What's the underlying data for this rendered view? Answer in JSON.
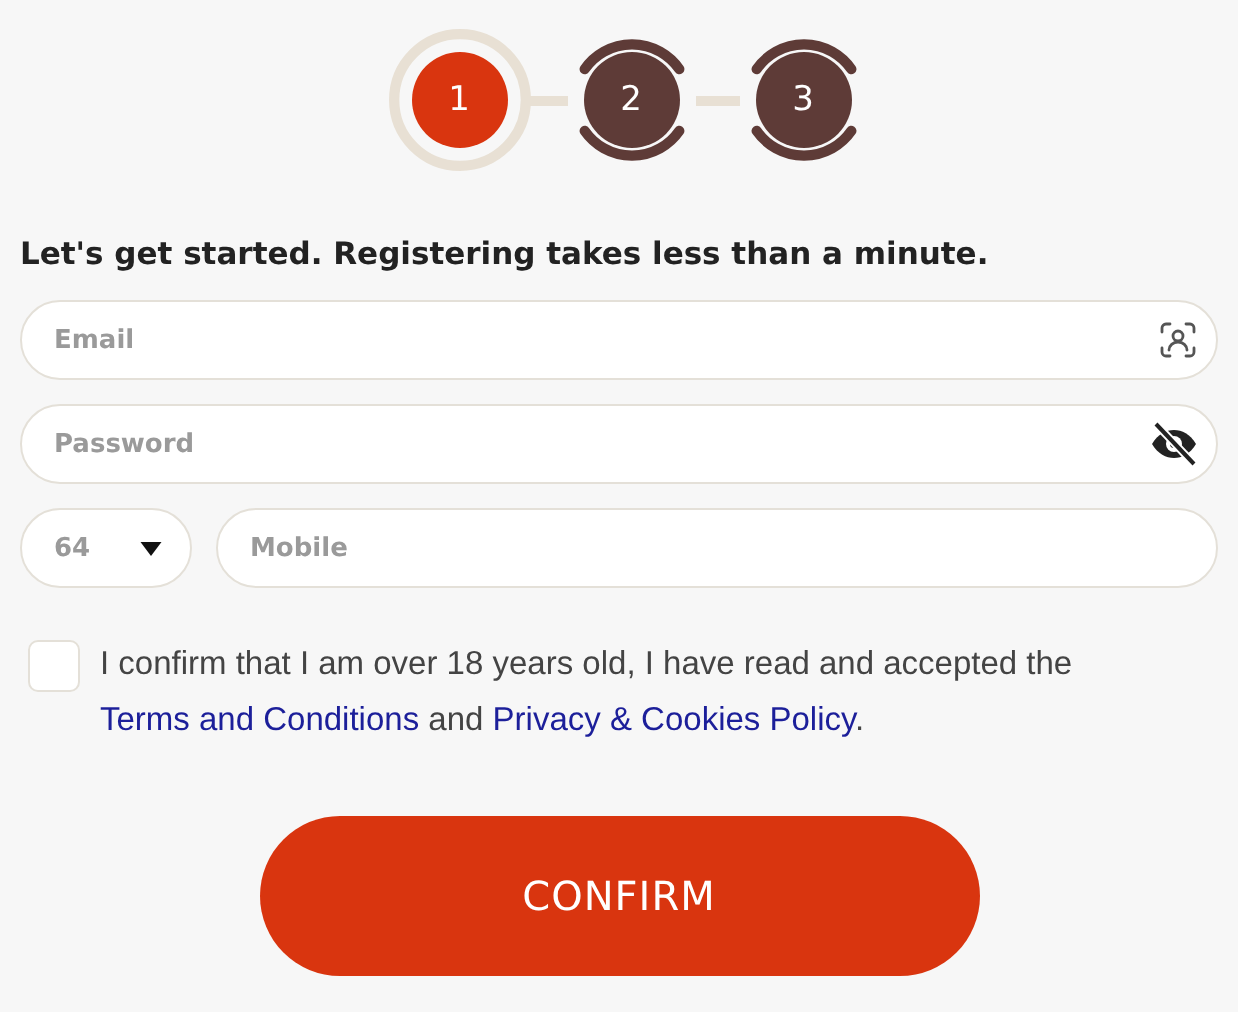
{
  "steps": [
    {
      "label": "1",
      "selected": true
    },
    {
      "label": "2",
      "selected": false
    },
    {
      "label": "3",
      "selected": false
    }
  ],
  "heading": "Let's get started. Registering takes less than a minute.",
  "email": {
    "placeholder": "Email"
  },
  "password": {
    "placeholder": "Password"
  },
  "country_code": {
    "value": "64"
  },
  "mobile": {
    "placeholder": "Mobile"
  },
  "consent": {
    "checked": false,
    "parts": [
      {
        "kind": "text",
        "text": "I confirm that I am over 18 years old, I have read and accepted the "
      },
      {
        "kind": "link",
        "text": "Terms and Conditions"
      },
      {
        "kind": "text",
        "text": " and "
      },
      {
        "kind": "link",
        "text": "Privacy & Cookies Policy"
      },
      {
        "kind": "text",
        "text": "."
      }
    ]
  },
  "confirm_button": "CONFIRM"
}
